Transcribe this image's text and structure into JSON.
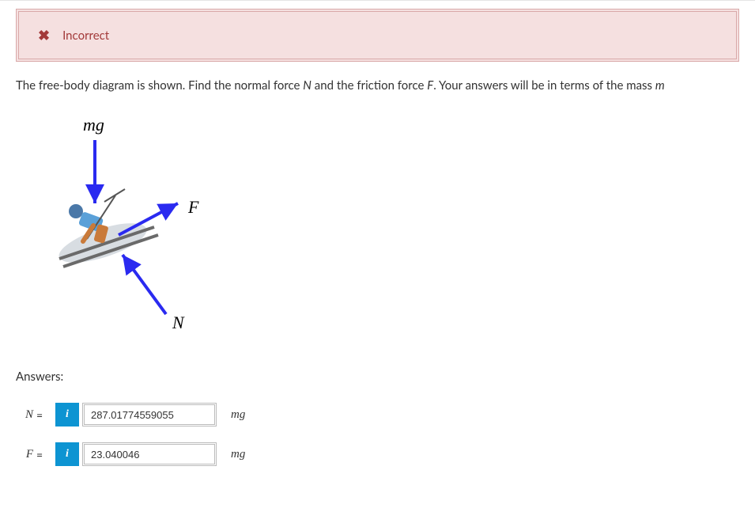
{
  "alert": {
    "icon_glyph": "✖",
    "text": "Incorrect"
  },
  "question": {
    "prefix": "The free-body diagram is shown. Find the normal force ",
    "var1": "N",
    "mid": " and the friction force ",
    "var2": "F",
    "suffix": ". Your answers will be in terms of the mass ",
    "var3": "m"
  },
  "diagram": {
    "label_mg": "mg",
    "label_F": "F",
    "label_N": "N"
  },
  "answers": {
    "heading": "Answers:",
    "rows": [
      {
        "var": "N",
        "eq": "=",
        "value": "287.01774559055",
        "unit": "mg"
      },
      {
        "var": "F",
        "eq": "=",
        "value": "23.040046",
        "unit": "mg"
      }
    ],
    "info_label": "i"
  }
}
